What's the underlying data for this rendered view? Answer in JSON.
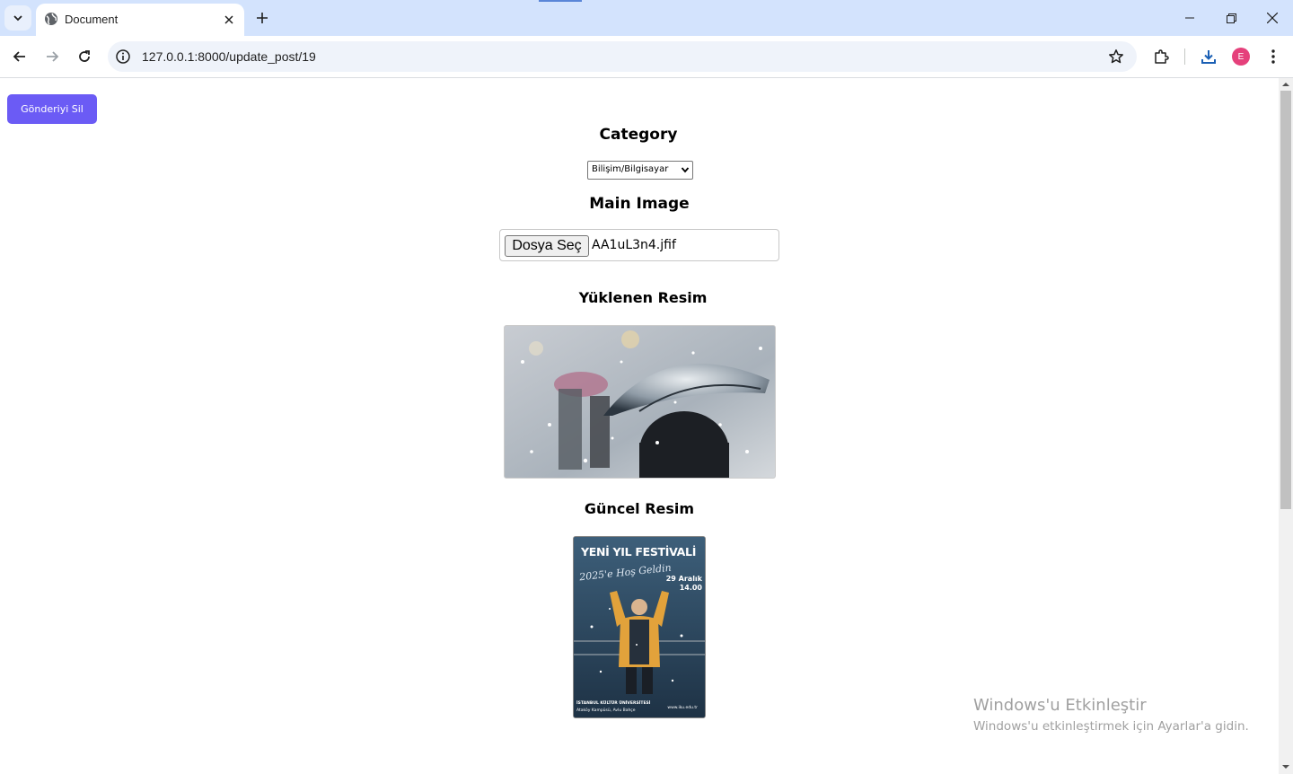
{
  "browser": {
    "tab_title": "Document",
    "url": "127.0.0.1:8000/update_post/19",
    "profile_initial": "E"
  },
  "page": {
    "delete_button": "Gönderiyi Sil",
    "category_heading": "Category",
    "category_selected": "Bilişim/Bilgisayar",
    "main_image_heading": "Main Image",
    "file_button": "Dosya Seç",
    "file_name": "AA1uL3n4.jfif",
    "uploaded_heading": "Yüklenen Resim",
    "current_heading": "Güncel Resim",
    "poster": {
      "title": "YENİ YIL FESTİVALİ",
      "script": "2025'e Hoş Geldin",
      "date_line1": "29 Aralık",
      "date_line2": "14.00",
      "footer_line1": "İSTANBUL KÜLTÜR ÜNİVERSİTESİ",
      "footer_line2": "Ataköy Kampüsü, Avlu Bahçe",
      "website": "www.iku.edu.tr"
    }
  },
  "os_watermark": {
    "line1": "Windows'u Etkinleştir",
    "line2": "Windows'u etkinleştirmek için Ayarlar'a gidin."
  },
  "colors": {
    "tabbar": "#d3e3fd",
    "button_accent": "#6b5bf5",
    "avatar": "#e5407b"
  }
}
